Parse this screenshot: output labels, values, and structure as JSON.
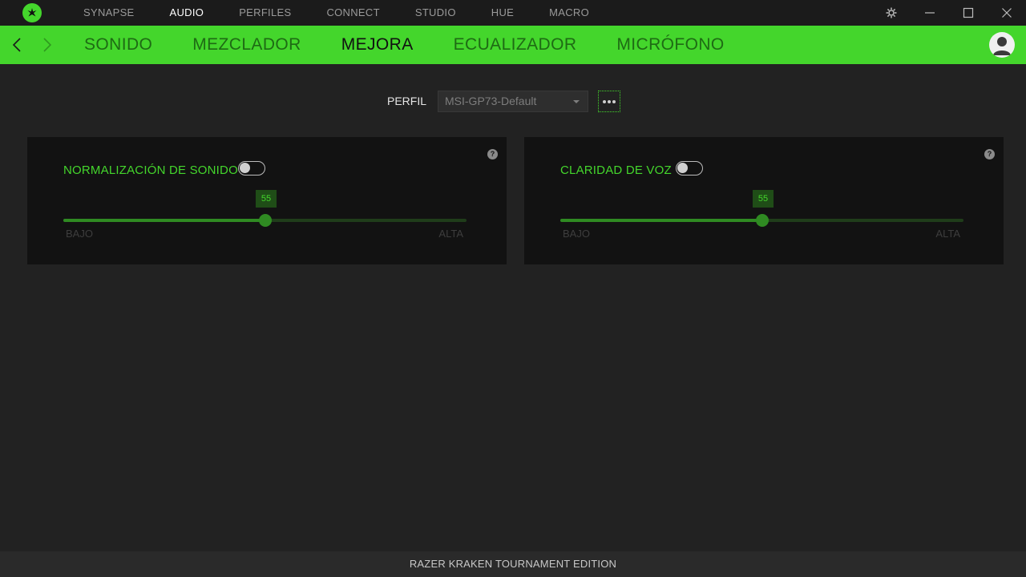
{
  "app": {
    "logo_icon": "razer-logo-icon",
    "accent_color": "#44d62c"
  },
  "topnav": {
    "items": [
      {
        "label": "SYNAPSE",
        "active": false
      },
      {
        "label": "AUDIO",
        "active": true
      },
      {
        "label": "PERFILES",
        "active": false
      },
      {
        "label": "CONNECT",
        "active": false
      },
      {
        "label": "STUDIO",
        "active": false
      },
      {
        "label": "HUE",
        "active": false
      },
      {
        "label": "MACRO",
        "active": false
      }
    ]
  },
  "window_controls": [
    "gear-icon",
    "minimize-icon",
    "maximize-icon",
    "close-icon"
  ],
  "subnav": {
    "tabs": [
      {
        "label": "SONIDO",
        "active": false
      },
      {
        "label": "MEZCLADOR",
        "active": false
      },
      {
        "label": "MEJORA",
        "active": true
      },
      {
        "label": "ECUALIZADOR",
        "active": false
      },
      {
        "label": "MICRÓFONO",
        "active": false
      }
    ]
  },
  "profile": {
    "label": "PERFIL",
    "selected": "MSI-GP73-Default"
  },
  "cards": [
    {
      "title": "NORMALIZACIÓN DE SONIDO",
      "enabled": false,
      "value": 55,
      "value_text": "55",
      "low_label": "BAJO",
      "high_label": "ALTA"
    },
    {
      "title": "CLARIDAD DE VOZ",
      "enabled": false,
      "value": 55,
      "value_text": "55",
      "low_label": "BAJO",
      "high_label": "ALTA"
    }
  ],
  "footer": {
    "device": "RAZER KRAKEN TOURNAMENT EDITION"
  }
}
